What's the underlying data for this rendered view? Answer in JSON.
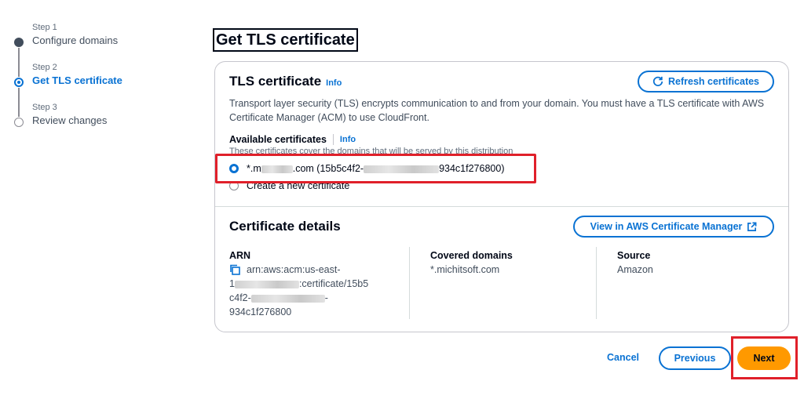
{
  "stepper": {
    "steps": [
      {
        "num": "Step 1",
        "label": "Configure domains"
      },
      {
        "num": "Step 2",
        "label": "Get TLS certificate"
      },
      {
        "num": "Step 3",
        "label": "Review changes"
      }
    ]
  },
  "page": {
    "title": "Get TLS certificate"
  },
  "tls": {
    "heading": "TLS certificate",
    "info": "Info",
    "refresh_label": "Refresh certificates",
    "description": "Transport layer security (TLS) encrypts communication to and from your domain. You must have a TLS certificate with AWS Certificate Manager (ACM) to use CloudFront.",
    "available_label": "Available certificates",
    "available_info": "Info",
    "available_hint": "These certificates cover the domains that will be served by this distribution",
    "option1_prefix": "*.m",
    "option1_mid": ".com (15b5c4f2-",
    "option1_suffix": "934c1f276800)",
    "option2": "Create a new certificate"
  },
  "details": {
    "heading": "Certificate details",
    "view_label": "View in AWS Certificate Manager",
    "arn_key": "ARN",
    "arn_line1": "arn:aws:acm:us-east-",
    "arn_line2_prefix": "1",
    "arn_line2_suffix": ":certificate/15b5",
    "arn_line3_prefix": "c4f2-",
    "arn_line3_suffix": "-",
    "arn_line4": "934c1f276800",
    "domains_key": "Covered domains",
    "domains_value": "*.michitsoft.com",
    "source_key": "Source",
    "source_value": "Amazon"
  },
  "footer": {
    "cancel": "Cancel",
    "previous": "Previous",
    "next": "Next"
  },
  "colors": {
    "accent": "#0972d3",
    "primary_button": "#ff9900",
    "highlight": "#e0202a"
  }
}
